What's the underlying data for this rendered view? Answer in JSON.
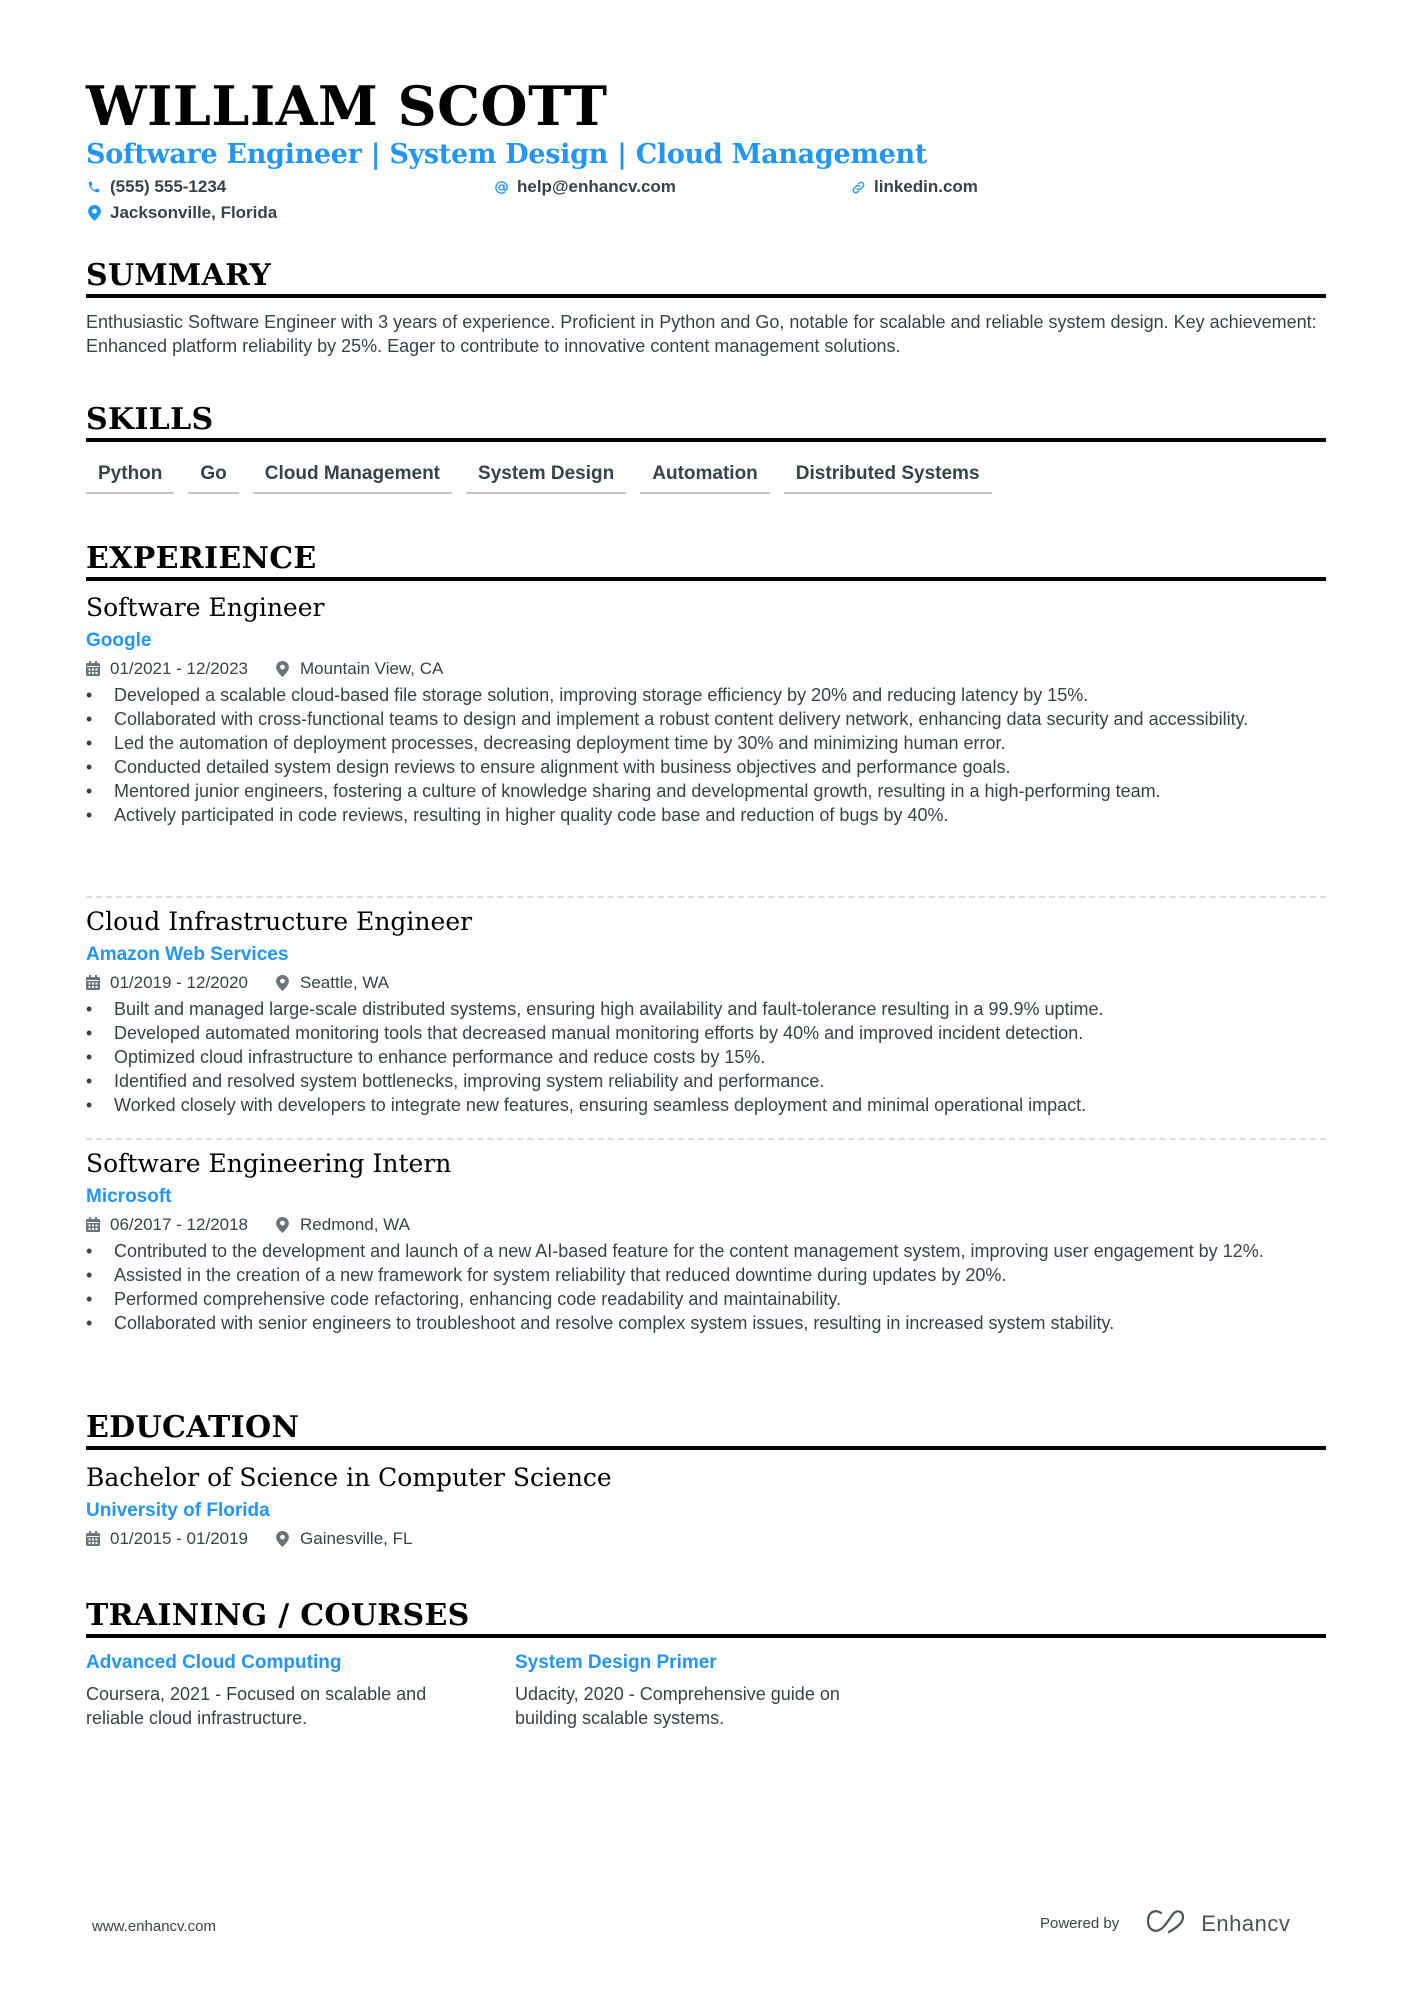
{
  "header": {
    "name": "WILLIAM SCOTT",
    "headline": "Software Engineer | System Design | Cloud Management",
    "contacts": {
      "phone": {
        "icon": "phone-icon",
        "value": "(555) 555-1234"
      },
      "email": {
        "icon": "at-icon",
        "value": "help@enhancv.com"
      },
      "linkedin": {
        "icon": "link-icon",
        "value": "linkedin.com"
      },
      "location": {
        "icon": "map-pin-icon",
        "value": "Jacksonville, Florida"
      }
    }
  },
  "summary": {
    "title": "SUMMARY",
    "text": "Enthusiastic Software Engineer with 3 years of experience. Proficient in Python and Go, notable for scalable and reliable system design. Key achievement: Enhanced platform reliability by 25%. Eager to contribute to innovative content management solutions."
  },
  "skills": {
    "title": "SKILLS",
    "items": [
      "Python",
      "Go",
      "Cloud Management",
      "System Design",
      "Automation",
      "Distributed Systems"
    ]
  },
  "experience": {
    "title": "EXPERIENCE",
    "items": [
      {
        "role": "Software Engineer",
        "company": "Google",
        "dates": "01/2021 - 12/2023",
        "location": "Mountain View, CA",
        "bullets": [
          "Developed a scalable cloud-based file storage solution, improving storage efficiency by 20% and reducing latency by 15%.",
          "Collaborated with cross-functional teams to design and implement a robust content delivery network, enhancing data security and accessibility.",
          "Led the automation of deployment processes, decreasing deployment time by 30% and minimizing human error.",
          "Conducted detailed system design reviews to ensure alignment with business objectives and performance goals.",
          "Mentored junior engineers, fostering a culture of knowledge sharing and developmental growth, resulting in a high-performing team.",
          "Actively participated in code reviews, resulting in higher quality code base and reduction of bugs by 40%."
        ]
      },
      {
        "role": "Cloud Infrastructure Engineer",
        "company": "Amazon Web Services",
        "dates": "01/2019 - 12/2020",
        "location": "Seattle, WA",
        "bullets": [
          "Built and managed large-scale distributed systems, ensuring high availability and fault-tolerance resulting in a 99.9% uptime.",
          "Developed automated monitoring tools that decreased manual monitoring efforts by 40% and improved incident detection.",
          "Optimized cloud infrastructure to enhance performance and reduce costs by 15%.",
          "Identified and resolved system bottlenecks, improving system reliability and performance.",
          "Worked closely with developers to integrate new features, ensuring seamless deployment and minimal operational impact."
        ]
      },
      {
        "role": "Software Engineering Intern",
        "company": "Microsoft",
        "dates": "06/2017 - 12/2018",
        "location": "Redmond, WA",
        "bullets": [
          "Contributed to the development and launch of a new AI-based feature for the content management system, improving user engagement by 12%.",
          "Assisted in the creation of a new framework for system reliability that reduced downtime during updates by 20%.",
          "Performed comprehensive code refactoring, enhancing code readability and maintainability.",
          "Collaborated with senior engineers to troubleshoot and resolve complex system issues, resulting in increased system stability."
        ]
      }
    ]
  },
  "education": {
    "title": "EDUCATION",
    "items": [
      {
        "degree": "Bachelor of Science in Computer Science",
        "school": "University of Florida",
        "dates": "01/2015 - 01/2019",
        "location": "Gainesville, FL"
      }
    ]
  },
  "training": {
    "title": "TRAINING / COURSES",
    "items": [
      {
        "title": "Advanced Cloud Computing",
        "description": "Coursera, 2021 - Focused on scalable and reliable cloud infrastructure."
      },
      {
        "title": "System Design Primer",
        "description": "Udacity, 2020 - Comprehensive guide on building scalable systems."
      }
    ]
  },
  "footer": {
    "website": "www.enhancv.com",
    "powered_by": "Powered by",
    "brand": "Enhancv"
  },
  "colors": {
    "accent": "#2196f3",
    "text": "#384347",
    "heading": "#000000"
  }
}
